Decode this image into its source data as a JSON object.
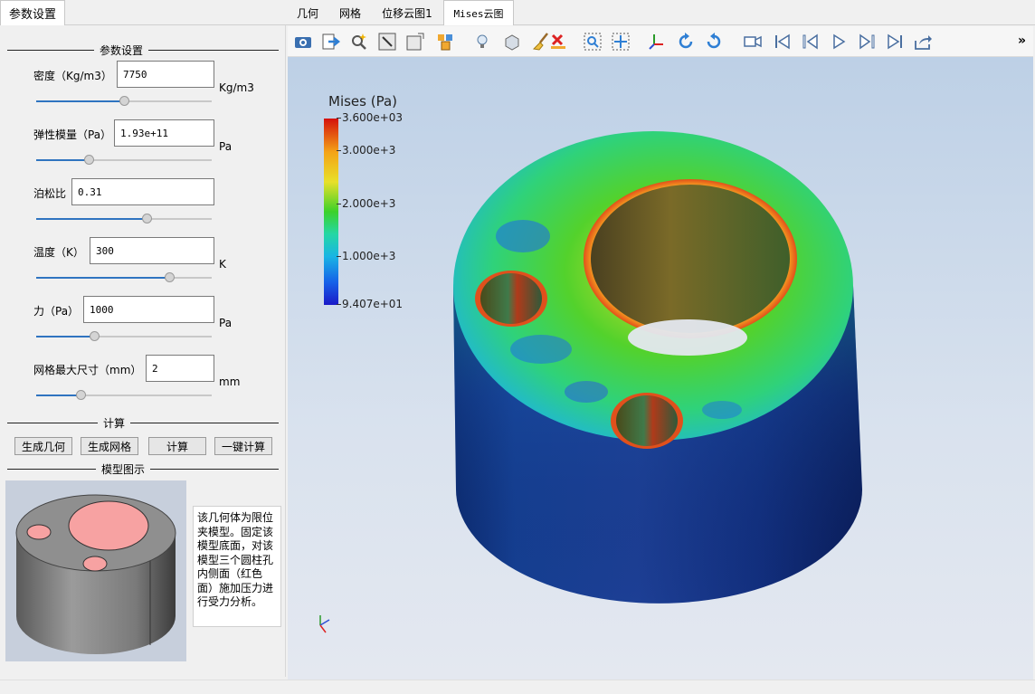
{
  "left_tab": "参数设置",
  "params_group_title": "参数设置",
  "params": [
    {
      "label": "密度（Kg/m3）",
      "value": "7750",
      "unit": "Kg/m3",
      "slider": 0.5
    },
    {
      "label": "弹性模量（Pa）",
      "value": "1.93e+11",
      "unit": "Pa",
      "slider": 0.3
    },
    {
      "label": "泊松比",
      "value": "0.31",
      "unit": "",
      "slider": 0.63
    },
    {
      "label": "温度（K）",
      "value": "300",
      "unit": "K",
      "slider": 0.76
    },
    {
      "label": "力（Pa）",
      "value": "1000",
      "unit": "Pa",
      "slider": 0.33
    },
    {
      "label": "网格最大尺寸（mm）",
      "value": "2",
      "unit": "mm",
      "slider": 0.25
    }
  ],
  "calc_group_title": "计算",
  "buttons": {
    "gen_geometry": "生成几何",
    "gen_mesh": "生成网格",
    "compute": "计算",
    "one_click": "一键计算"
  },
  "model_group_title": "模型图示",
  "model_description": "该几何体为限位夹模型。固定该模型底面，对该模型三个圆柱孔内侧面（红色面）施加压力进行受力分析。",
  "right_tabs": [
    "几何",
    "网格",
    "位移云图1",
    "Mises云图"
  ],
  "active_tab_index": 3,
  "toolbar_icons": [
    "camera-icon",
    "export-icon",
    "zoom-magic-icon",
    "select-box-icon",
    "window-icon",
    "boxes-icon",
    "light-bulb-icon",
    "cube-icon",
    "broom-icon",
    "delete-icon",
    "zoom-fit-icon",
    "pan-icon",
    "axes-icon",
    "rotate-cw-icon",
    "rotate-ccw-icon",
    "video-camera-icon",
    "first-frame-icon",
    "prev-frame-icon",
    "play-icon",
    "next-frame-icon",
    "last-frame-icon",
    "share-icon"
  ],
  "legend": {
    "title": "Mises (Pa)",
    "ticks": [
      "3.600e+03",
      "3.000e+3",
      "2.000e+3",
      "1.000e+3",
      "9.407e+01"
    ]
  }
}
